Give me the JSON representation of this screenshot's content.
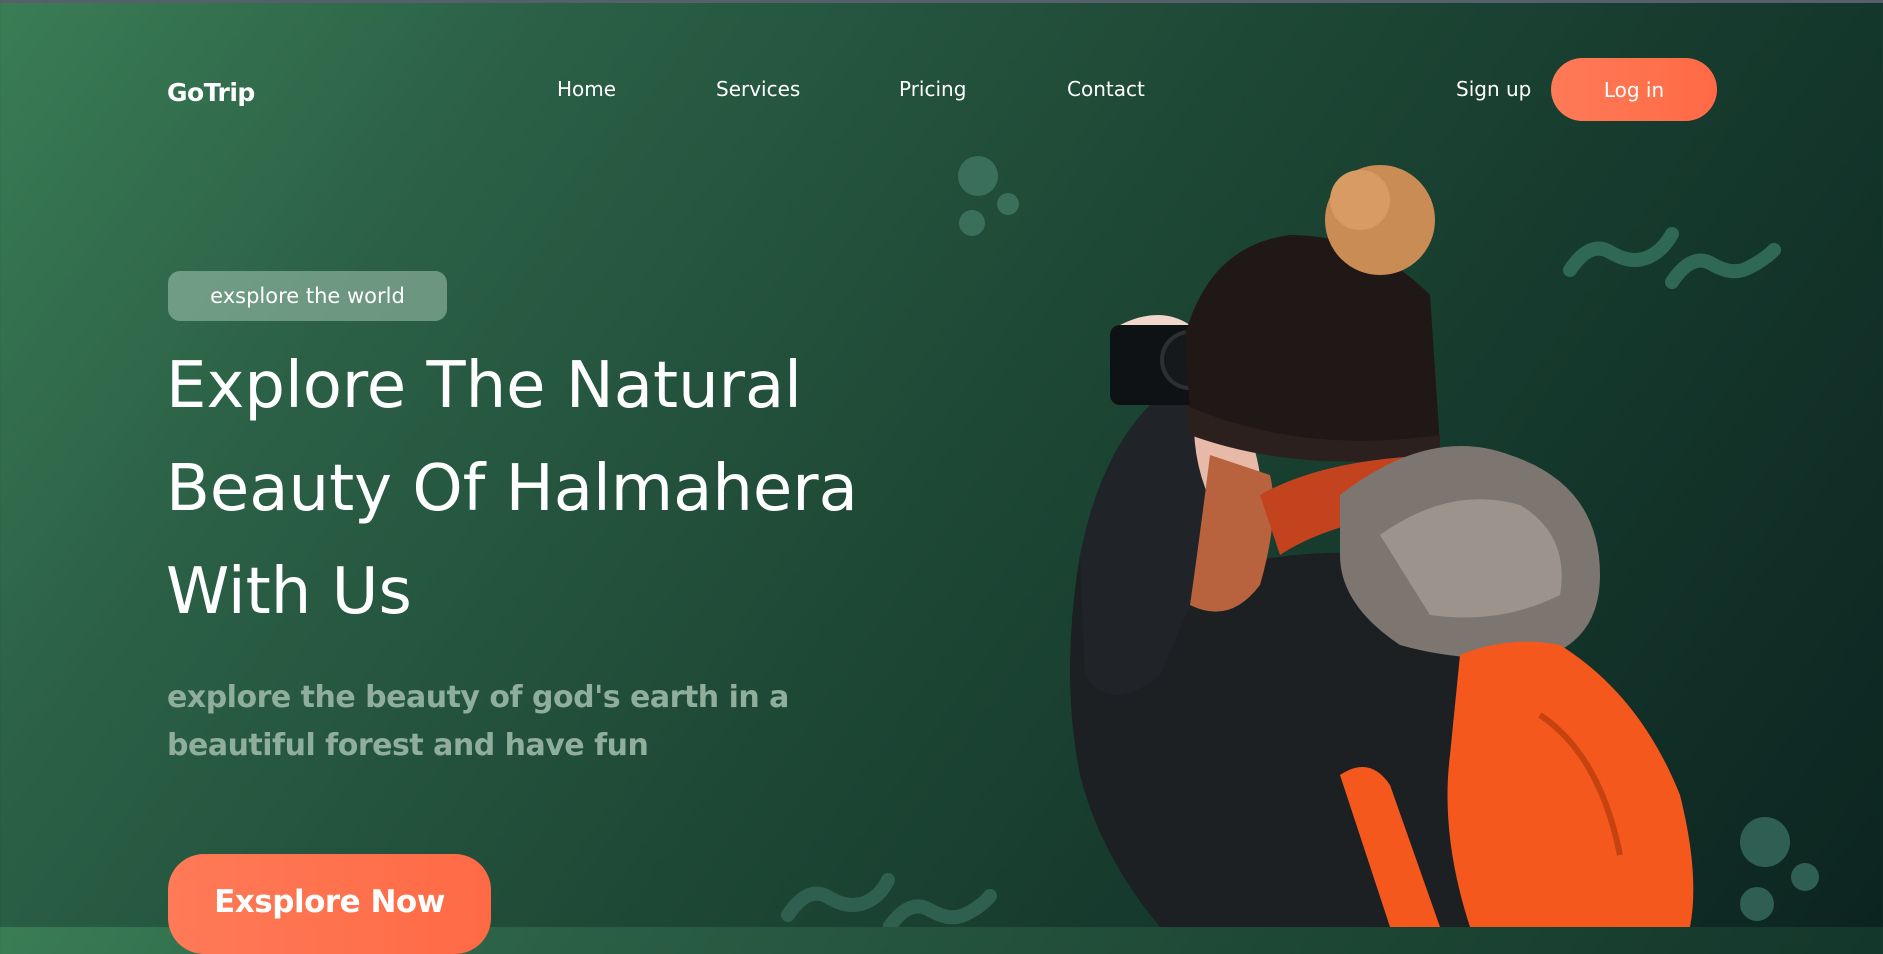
{
  "header": {
    "logo": "GoTrip",
    "nav": [
      "Home",
      "Services",
      "Pricing",
      "Contact"
    ],
    "signup_label": "Sign up",
    "login_label": "Log in"
  },
  "hero": {
    "badge": "exsplore the world",
    "headline_lines": [
      "Explore The Natural",
      "Beauty Of Halmahera",
      "With Us"
    ],
    "subtitle": "explore the beauty of god's earth in a beautiful forest and have fun",
    "cta_label": "Exsplore Now"
  },
  "colors": {
    "accent": "#ff6f4e",
    "bg_start": "#3a7d55",
    "bg_end": "#0c2420",
    "subtitle": "#8fae9c"
  },
  "icons": {
    "decor_dots": "circle-cluster",
    "decor_waves": "zigzag-wave"
  }
}
